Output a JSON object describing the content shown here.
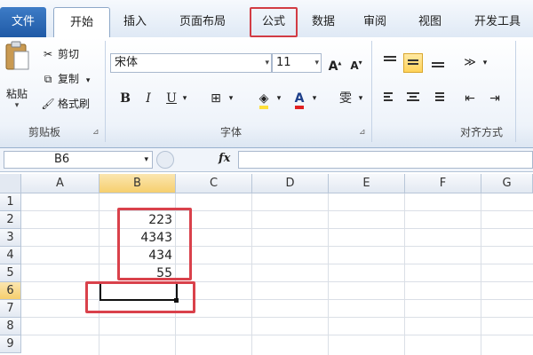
{
  "tabs": {
    "file": "文件",
    "home": "开始",
    "insert": "插入",
    "page_layout": "页面布局",
    "formulas": "公式",
    "data": "数据",
    "review": "审阅",
    "view": "视图",
    "developer": "开发工具"
  },
  "clipboard": {
    "paste": "粘贴",
    "cut": "剪切",
    "copy": "复制",
    "format_painter": "格式刷",
    "group_label": "剪贴板"
  },
  "font": {
    "name": "宋体",
    "size": "11",
    "bold": "B",
    "italic": "I",
    "underline": "U",
    "group_label": "字体"
  },
  "alignment": {
    "group_label": "对齐方式"
  },
  "formula_bar": {
    "name_box": "B6",
    "fx": "fx",
    "formula": ""
  },
  "grid": {
    "columns": [
      "A",
      "B",
      "C",
      "D",
      "E",
      "F",
      "G"
    ],
    "rows": [
      "1",
      "2",
      "3",
      "4",
      "5",
      "6",
      "7",
      "8",
      "9"
    ],
    "selected_column": "B",
    "selected_row": "6",
    "cells": {
      "B2": "223",
      "B3": "4343",
      "B4": "434",
      "B5": "55"
    }
  },
  "colors": {
    "highlight": "#d9414b",
    "selection": "#f6cf6e",
    "file_tab": "#1f5aa6"
  }
}
